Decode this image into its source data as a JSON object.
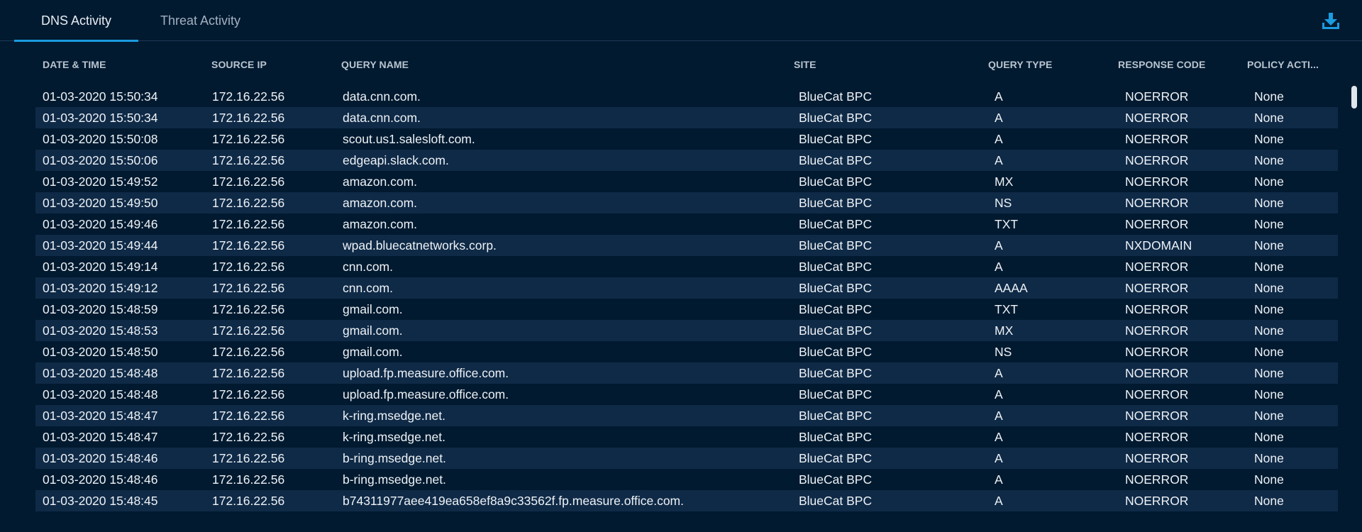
{
  "tabs": [
    {
      "label": "DNS Activity",
      "active": true
    },
    {
      "label": "Threat Activity",
      "active": false
    }
  ],
  "toolbar": {
    "download_icon": "download-icon"
  },
  "colors": {
    "background": "#011a30",
    "accent": "#1b9be0",
    "row_alt": "#0f2a47"
  },
  "table": {
    "columns": [
      "DATE & TIME",
      "SOURCE IP",
      "QUERY NAME",
      "SITE",
      "QUERY TYPE",
      "RESPONSE CODE",
      "POLICY ACTI..."
    ],
    "rows": [
      [
        "01-03-2020 15:50:34",
        "172.16.22.56",
        "data.cnn.com.",
        "BlueCat BPC",
        "A",
        "NOERROR",
        "None"
      ],
      [
        "01-03-2020 15:50:34",
        "172.16.22.56",
        "data.cnn.com.",
        "BlueCat BPC",
        "A",
        "NOERROR",
        "None"
      ],
      [
        "01-03-2020 15:50:08",
        "172.16.22.56",
        "scout.us1.salesloft.com.",
        "BlueCat BPC",
        "A",
        "NOERROR",
        "None"
      ],
      [
        "01-03-2020 15:50:06",
        "172.16.22.56",
        "edgeapi.slack.com.",
        "BlueCat BPC",
        "A",
        "NOERROR",
        "None"
      ],
      [
        "01-03-2020 15:49:52",
        "172.16.22.56",
        "amazon.com.",
        "BlueCat BPC",
        "MX",
        "NOERROR",
        "None"
      ],
      [
        "01-03-2020 15:49:50",
        "172.16.22.56",
        "amazon.com.",
        "BlueCat BPC",
        "NS",
        "NOERROR",
        "None"
      ],
      [
        "01-03-2020 15:49:46",
        "172.16.22.56",
        "amazon.com.",
        "BlueCat BPC",
        "TXT",
        "NOERROR",
        "None"
      ],
      [
        "01-03-2020 15:49:44",
        "172.16.22.56",
        "wpad.bluecatnetworks.corp.",
        "BlueCat BPC",
        "A",
        "NXDOMAIN",
        "None"
      ],
      [
        "01-03-2020 15:49:14",
        "172.16.22.56",
        "cnn.com.",
        "BlueCat BPC",
        "A",
        "NOERROR",
        "None"
      ],
      [
        "01-03-2020 15:49:12",
        "172.16.22.56",
        "cnn.com.",
        "BlueCat BPC",
        "AAAA",
        "NOERROR",
        "None"
      ],
      [
        "01-03-2020 15:48:59",
        "172.16.22.56",
        "gmail.com.",
        "BlueCat BPC",
        "TXT",
        "NOERROR",
        "None"
      ],
      [
        "01-03-2020 15:48:53",
        "172.16.22.56",
        "gmail.com.",
        "BlueCat BPC",
        "MX",
        "NOERROR",
        "None"
      ],
      [
        "01-03-2020 15:48:50",
        "172.16.22.56",
        "gmail.com.",
        "BlueCat BPC",
        "NS",
        "NOERROR",
        "None"
      ],
      [
        "01-03-2020 15:48:48",
        "172.16.22.56",
        "upload.fp.measure.office.com.",
        "BlueCat BPC",
        "A",
        "NOERROR",
        "None"
      ],
      [
        "01-03-2020 15:48:48",
        "172.16.22.56",
        "upload.fp.measure.office.com.",
        "BlueCat BPC",
        "A",
        "NOERROR",
        "None"
      ],
      [
        "01-03-2020 15:48:47",
        "172.16.22.56",
        "k-ring.msedge.net.",
        "BlueCat BPC",
        "A",
        "NOERROR",
        "None"
      ],
      [
        "01-03-2020 15:48:47",
        "172.16.22.56",
        "k-ring.msedge.net.",
        "BlueCat BPC",
        "A",
        "NOERROR",
        "None"
      ],
      [
        "01-03-2020 15:48:46",
        "172.16.22.56",
        "b-ring.msedge.net.",
        "BlueCat BPC",
        "A",
        "NOERROR",
        "None"
      ],
      [
        "01-03-2020 15:48:46",
        "172.16.22.56",
        "b-ring.msedge.net.",
        "BlueCat BPC",
        "A",
        "NOERROR",
        "None"
      ],
      [
        "01-03-2020 15:48:45",
        "172.16.22.56",
        "b74311977aee419ea658ef8a9c33562f.fp.measure.office.com.",
        "BlueCat BPC",
        "A",
        "NOERROR",
        "None"
      ]
    ]
  }
}
